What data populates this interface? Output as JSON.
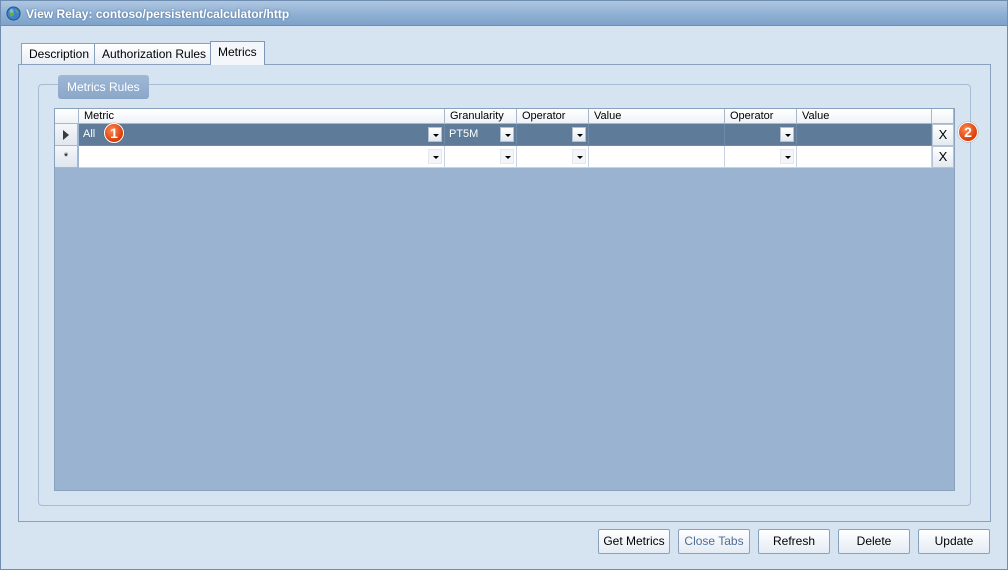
{
  "window": {
    "title": "View Relay: contoso/persistent/calculator/http",
    "icon": "globe-icon"
  },
  "tabs": [
    {
      "label": "Description",
      "active": false
    },
    {
      "label": "Authorization Rules",
      "active": false
    },
    {
      "label": "Metrics",
      "active": true
    }
  ],
  "group": {
    "label": "Metrics Rules"
  },
  "grid": {
    "columns": [
      "Metric",
      "Granularity",
      "Operator",
      "Value",
      "Operator",
      "Value"
    ],
    "rows": [
      {
        "indicator": "current-row-arrow",
        "metric": "All",
        "granularity": "PT5M",
        "operator1": "",
        "value1": "",
        "operator2": "",
        "value2": "",
        "delete": "X",
        "selected": true
      },
      {
        "indicator": "*",
        "metric": "",
        "granularity": "",
        "operator1": "",
        "value1": "",
        "operator2": "",
        "value2": "",
        "delete": "X",
        "selected": false
      }
    ]
  },
  "callouts": [
    "1",
    "2"
  ],
  "buttons": {
    "get_metrics": "Get Metrics",
    "close_tabs": "Close Tabs",
    "refresh": "Refresh",
    "delete": "Delete",
    "update": "Update"
  }
}
